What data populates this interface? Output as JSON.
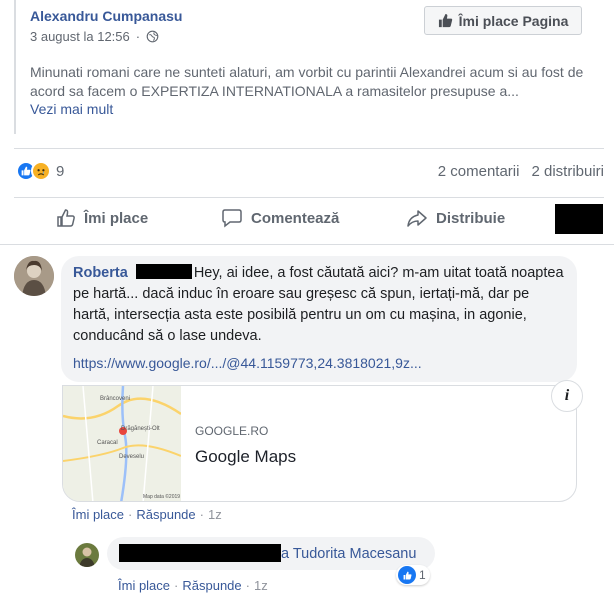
{
  "shared_post": {
    "author": "Alexandru Cumpanasu",
    "timestamp": "3 august la 12:56",
    "separator": "·",
    "privacy_icon": "globe-icon",
    "like_page_label": "Îmi place Pagina",
    "text": "Minunati romani care ne sunteti alaturi, am vorbit cu parintii Alexandrei acum si au fost de acord sa facem o EXPERTIZA INTERNATIONALA a ramasitelor presupuse a...",
    "see_more": "Vezi mai mult"
  },
  "stats": {
    "reaction_icons": [
      "like-icon",
      "sad-icon"
    ],
    "reaction_count": "9",
    "comments": "2 comentarii",
    "shares": "2 distribuiri"
  },
  "actions": {
    "like": "Îmi place",
    "comment": "Comentează",
    "share": "Distribuie"
  },
  "comment": {
    "author": "Roberta",
    "text": "Hey, ai idee, a fost căutată aici? m-am uitat toată noaptea pe hartă... dacă induc în eroare sau greșesc că spun, iertați-mă, dar pe hartă, intersecția asta este posibilă pentru un om cu mașina, in agonie, conducând să o lase undeva.",
    "link": "https://www.google.ro/.../@44.1159773,24.3818021,9z...",
    "preview": {
      "domain": "GOOGLE.RO",
      "title": "Google Maps",
      "map_labels": [
        "Brâncoveni",
        "Drăgănești-Olt",
        "Caracal",
        "Deveselu",
        "Map data ©2019"
      ]
    },
    "info_label": "i",
    "like_label": "Îmi place",
    "reply_label": "Răspunde",
    "dot": "·",
    "time": "1z"
  },
  "reply": {
    "author_partial": "a Tudorita Macesanu",
    "like_label": "Îmi place",
    "reply_label": "Răspunde",
    "dot": "·",
    "time": "1z",
    "reaction_count": "1"
  },
  "colors": {
    "link": "#385898",
    "meta": "#616770",
    "like_blue": "#1877f2",
    "sad_yellow": "#f7b125",
    "bubble": "#f2f3f5"
  }
}
